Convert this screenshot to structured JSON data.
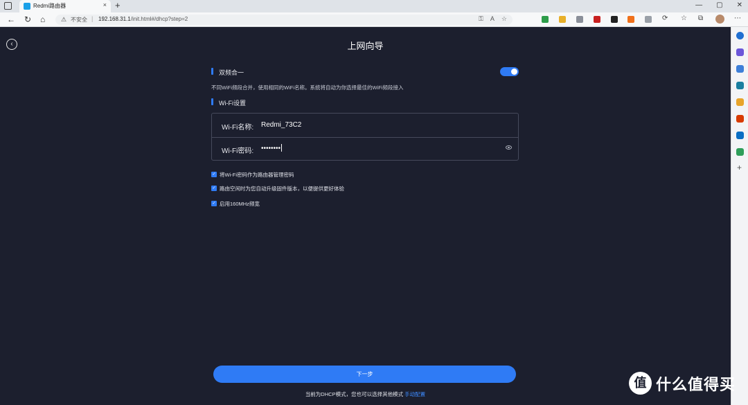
{
  "browser": {
    "tab_title": "Redmi路由器",
    "tab_close": "×",
    "new_tab": "+",
    "insecure_label": "不安全",
    "url_host": "192.168.31.1",
    "url_path": "/init.html#/dhcp?step=2",
    "controls": [
      "—",
      "▢",
      "✕"
    ]
  },
  "page": {
    "title": "上网向导",
    "back_icon": "‹",
    "dual_band": {
      "title": "双频合一",
      "enabled": true,
      "hint": "不同WiFi频段合并，使用相同的WiFi名称。系统将自动为你选择最佳的WiFi频段接入"
    },
    "wifi": {
      "section_title": "Wi-Fi设置",
      "name_label": "Wi-Fi名称:",
      "name_value": "Redmi_73C2",
      "password_label": "Wi-Fi密码:",
      "password_mask": "••••••••"
    },
    "options": [
      {
        "label": "将Wi-Fi密码作为路由器管理密码",
        "checked": true
      },
      {
        "label": "路由空闲时为您自动升级固件版本，以便提供更好体验",
        "checked": true
      },
      {
        "label": "启用160MHz频宽",
        "checked": true
      }
    ],
    "next_button": "下一步",
    "footer_text": "当前为DHCP模式，您也可以选择其他模式",
    "footer_link": "手动配置"
  },
  "watermark": {
    "logo": "值",
    "text": "什么值得买"
  },
  "colors": {
    "accent": "#2f7bf5",
    "background": "#1c1f2e"
  }
}
